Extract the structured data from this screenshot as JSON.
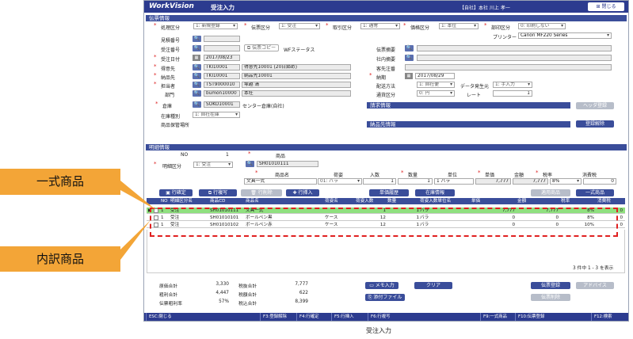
{
  "app": {
    "logo": "WorkVision",
    "title": "受注入力",
    "user": "【自社】本社 川上 孝一",
    "close": "閉じる"
  },
  "header": {
    "section": "伝票情報",
    "labels": {
      "proc": "処理区分",
      "slip": "伝票区分",
      "trade": "取引区分",
      "tax": "価格区分",
      "dept": "部印区分",
      "printer": "プリンター",
      "est": "見積番号",
      "order_no": "受注番号",
      "order_date": "受注日付",
      "customer": "得意先",
      "delivery": "納品先",
      "staff": "担当者",
      "section_dept": "部門",
      "warehouse": "倉庫",
      "stock_type": "在庫種別",
      "product_place": "商品保管場所",
      "slip_summary": "伝票摘要",
      "internal": "社内摘要",
      "cust_order": "客先注番",
      "due": "納期",
      "ship_method": "配送方法",
      "ship_origin": "データ発生元",
      "currency": "通貨区分",
      "rate": "レート",
      "bill": "請求情報",
      "deliver_info": "納品先情報"
    },
    "values": {
      "proc": "1: 新規登録",
      "slip": "1: 受注",
      "trade": "1: 通常",
      "tax": "1: 本位",
      "dept": "0: 印刷しない",
      "printer": "Canon MF220 Series",
      "copy_btn": "伝票コピー",
      "wf": "WFステータス",
      "order_date": "2017/08/23",
      "customer_cd": "TKI10001",
      "customer_nm": "得意先10001 (20日締め)",
      "delivery_cd": "TKI10001",
      "delivery_nm": "納品先10001",
      "staff_cd": "TST9000010",
      "staff_nm": "塚越 清",
      "section_cd": "bumon10000",
      "section_nm": "本社",
      "wh_cd": "SOKO10001",
      "wh_nm": "センター倉庫(自社)",
      "stock_type": "1: 自社在庫",
      "due": "2017/08/29",
      "ship_method": "1: 自社便",
      "ship_origin": "1: 手入力",
      "currency": "0: 円",
      "rate": "1",
      "header_reg": "ヘッダ登録",
      "reg_release": "登録解除"
    }
  },
  "detail": {
    "section": "明細情報",
    "labels": {
      "no": "NO",
      "detail_type": "明細区分",
      "product": "商品",
      "product_name": "商品名",
      "pack": "荷姿",
      "qty_in": "入数",
      "qty": "数量",
      "unit": "単位",
      "price": "単価",
      "amount": "金額",
      "tax": "税率",
      "tax_cons": "消費税"
    },
    "values": {
      "no": "1",
      "detail_type": "1: 受注",
      "product_cd": "SH01010111",
      "product_name": "文具一式",
      "pack": "01: バラ",
      "qty_in": "1",
      "qty": "1",
      "unit": "バラ",
      "price": "7,777",
      "amount": "7,777",
      "tax": "8%",
      "tax_cons": "0"
    },
    "buttons": {
      "confirm": "行確定",
      "copy": "行複写",
      "delete": "行削除",
      "insert": "行挿入",
      "history": "単価履歴",
      "stock": "在庫情報",
      "apply": "適用商品",
      "set": "一式商品"
    },
    "columns": [
      "NO",
      "明細区分名",
      "商品CD",
      "商品名",
      "荷姿名",
      "荷姿入数",
      "数量",
      "荷姿入数単位名",
      "単価",
      "金額",
      "税率",
      "消費税"
    ],
    "rows": [
      [
        "1",
        "受注",
        "SH01010111",
        "文具一式",
        "",
        "1",
        "1",
        "バラ",
        "7,777",
        "7,777",
        "8%",
        "0"
      ],
      [
        "1",
        "受注",
        "SH01010101",
        "ボールペン黒",
        "ケース",
        "12",
        "1",
        "バラ",
        "0",
        "0",
        "8%",
        "0"
      ],
      [
        "1",
        "受注",
        "SH01010102",
        "ボールペン赤",
        "ケース",
        "12",
        "1",
        "バラ",
        "0",
        "0",
        "10%",
        "0"
      ]
    ],
    "pager": "3 件中 1 - 3 を表示"
  },
  "totals": {
    "labels": [
      "原価合計",
      "粗利合計",
      "伝票粗利率",
      "税抜合計",
      "税額合計",
      "税込合計"
    ],
    "values": [
      "3,330",
      "4,447",
      "57%",
      "7,777",
      "622",
      "8,399"
    ]
  },
  "bottom": {
    "memo": "メモ入力",
    "clear": "クリア",
    "attach": "添付ファイル",
    "slip_reg": "伝票登録",
    "slip_del": "伝票削除",
    "upload": "アドバイス"
  },
  "fkeys": [
    "ESC:閉じる",
    "F3:登録解除",
    "F4:行確定",
    "F5:行挿入",
    "F6:行複写",
    "F9:一式商品",
    "F10:伝票登録",
    "F12:検索"
  ],
  "callouts": {
    "set": "一式商品",
    "breakdown": "内訳商品"
  },
  "caption": "受注入力",
  "colors": {
    "navy": "#2c3b8f",
    "green": "#8fe07f",
    "red": "#e02020",
    "orange": "#f3a537"
  }
}
